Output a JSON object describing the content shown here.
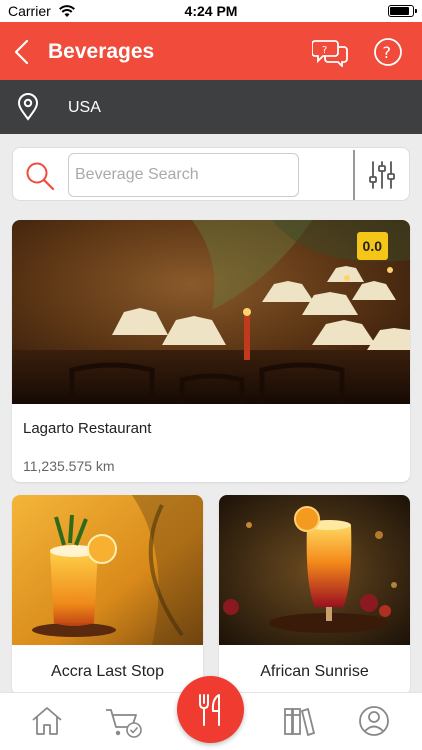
{
  "status_bar": {
    "carrier": "Carrier",
    "time": "4:24 PM",
    "battery_level": 0.9
  },
  "header": {
    "title": "Beverages"
  },
  "location": {
    "label": "USA"
  },
  "search": {
    "placeholder": "Beverage Search"
  },
  "featured": {
    "rating": "0.0",
    "name": "Lagarto Restaurant",
    "distance": "11,235.575 km"
  },
  "items": [
    {
      "name": "Accra Last Stop"
    },
    {
      "name": "African Sunrise"
    }
  ],
  "colors": {
    "accent": "#f04b3b",
    "location_bar": "#3d3f41",
    "rating_badge": "#f5c518"
  },
  "tabbar": {
    "tabs": [
      "home-icon",
      "cart-check-icon",
      "fork-knife-icon",
      "books-icon",
      "profile-icon"
    ],
    "active": "fork-knife-icon"
  }
}
